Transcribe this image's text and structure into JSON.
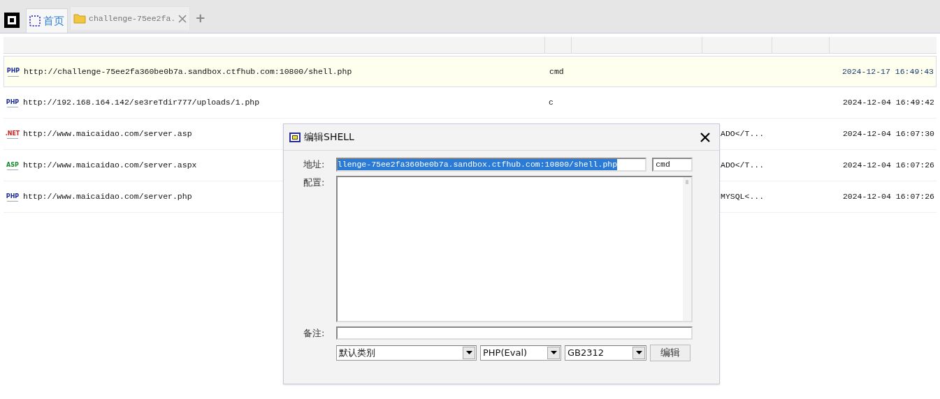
{
  "tabs": [
    {
      "label": "首页",
      "kind": "home",
      "selected": true,
      "closable": false
    },
    {
      "label": "challenge-75ee2fa.",
      "kind": "folder",
      "selected": false,
      "closable": true
    }
  ],
  "new_tab": "+",
  "table": {
    "rows": [
      {
        "type": "PHP",
        "url": "http://challenge-75ee2fa360be0b7a.sandbox.ctfhub.com:10800/shell.php",
        "column_2": "cmd",
        "date": "2024-12-17 16:49:43",
        "selected": true
      },
      {
        "type": "PHP",
        "url": "http://192.168.164.142/se3reTdir777/uploads/1.php",
        "column_2": "c",
        "date": "2024-12-04 16:49:42",
        "selected": false
      },
      {
        "type": ".NET",
        "url": "http://www.maicaidao.com/server.asp",
        "column_4": "ADO</T...",
        "date": "2024-12-04 16:07:30",
        "selected": false
      },
      {
        "type": "ASP",
        "url": "http://www.maicaidao.com/server.aspx",
        "column_4": "ADO</T...",
        "date": "2024-12-04 16:07:26",
        "selected": false
      },
      {
        "type": "PHP",
        "url": "http://www.maicaidao.com/server.php",
        "column_4": "MYSQL<...",
        "date": "2024-12-04 16:07:26",
        "selected": false
      }
    ]
  },
  "dialog": {
    "title": "编辑SHELL",
    "address_label": "地址:",
    "address": "llenge-75ee2fa360be0b7a.sandbox.ctfhub.com:10800/shell.php",
    "password": "cmd",
    "config_label": "配置:",
    "note_label": "备注:",
    "category": "默认类别",
    "script_type": "PHP(Eval)",
    "encoding": "GB2312",
    "submit": "编辑"
  }
}
